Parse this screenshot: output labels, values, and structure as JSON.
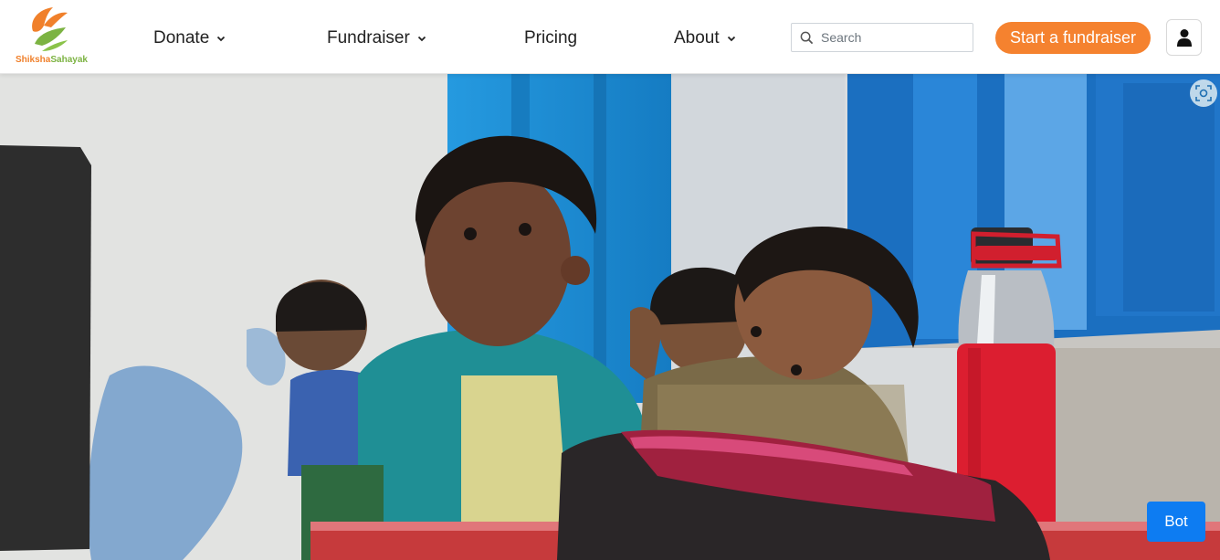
{
  "brand": {
    "name_part1": "Shiksha",
    "name_part2": "Sahayak",
    "colors": {
      "orange": "#f0802b",
      "green": "#7cb342"
    },
    "icon": "leaf-hands-logo"
  },
  "nav": {
    "items": [
      {
        "label": "Donate",
        "has_dropdown": true
      },
      {
        "label": "Fundraiser",
        "has_dropdown": true
      },
      {
        "label": "Pricing",
        "has_dropdown": false
      },
      {
        "label": "About",
        "has_dropdown": true
      }
    ]
  },
  "search": {
    "placeholder": "Search",
    "value": "",
    "icon": "search-icon"
  },
  "cta": {
    "label": "Start a fundraiser",
    "color": "#f5822f"
  },
  "user": {
    "icon": "user-icon"
  },
  "hero": {
    "image_alt": "Children sitting at classroom desks",
    "lens_icon": "image-search-icon"
  },
  "bot": {
    "label": "Bot",
    "color": "#0d7cf2"
  }
}
